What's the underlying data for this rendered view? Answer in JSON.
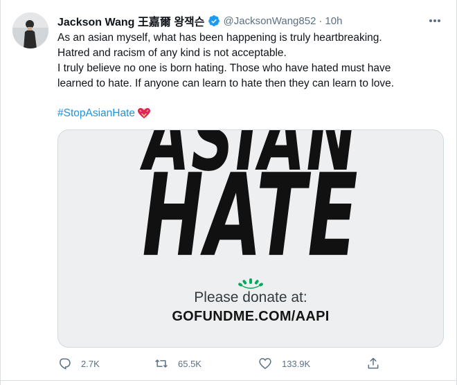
{
  "author": {
    "name": "Jackson Wang 王嘉爾 왕잭슨",
    "handle": "@JacksonWang852",
    "separator": "·",
    "time": "10h"
  },
  "tweet": {
    "lines": [
      "As an asian myself, what has been happening is truly heartbreaking.",
      "Hatred and racism of any kind is not acceptable.",
      "I truly believe no one is born hating. Those who have hated must have",
      "learned to hate. If anyone can learn to hate then they can learn to love."
    ],
    "hashtag": "#StopAsianHate"
  },
  "media": {
    "word_top": "ASIAN",
    "word_bottom": "HATE",
    "donate_text": "Please donate at:",
    "donate_url": "GOFUNDME.COM/AAPI",
    "logo_color": "#02a95c"
  },
  "actions": {
    "replies": "2.7K",
    "retweets": "65.5K",
    "likes": "133.9K"
  },
  "colors": {
    "link": "#1b95e0",
    "muted": "#5b7083",
    "verified": "#1d9bf0"
  },
  "icons": [
    "verified-badge-icon",
    "more-options-icon",
    "heart-emoji-icon",
    "reply-icon",
    "retweet-icon",
    "like-icon",
    "share-icon",
    "gofundme-logo-icon"
  ]
}
